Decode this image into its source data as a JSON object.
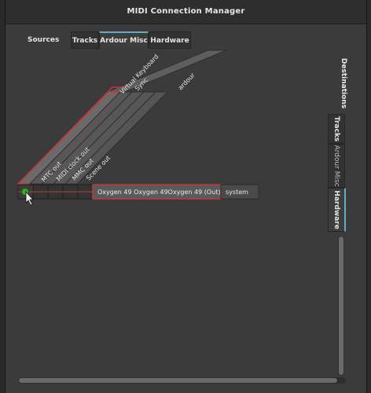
{
  "window": {
    "title": "MIDI Connection Manager"
  },
  "source_tabs": {
    "heading": "Sources",
    "items": [
      {
        "label": "Tracks",
        "active": false
      },
      {
        "label": "Ardour Misc",
        "active": true
      },
      {
        "label": "Hardware",
        "active": false
      }
    ]
  },
  "destination_tabs": {
    "heading": "Destinations",
    "items": [
      {
        "label": "Tracks",
        "active": false
      },
      {
        "label": "Ardour Misc",
        "active": false
      },
      {
        "label": "Hardware",
        "active": true
      }
    ]
  },
  "matrix": {
    "column_groups": [
      {
        "label": "Virtual Keyboard"
      },
      {
        "label": "Sync"
      },
      {
        "label": "ardour"
      }
    ],
    "columns": [
      {
        "label": "MTC out"
      },
      {
        "label": "MIDI clock out"
      },
      {
        "label": "MMC out"
      },
      {
        "label": "Scene out"
      }
    ],
    "row": {
      "label": "Oxygen 49 Oxygen 49Oxygen 49 (Out)",
      "group": "system"
    },
    "connected_column": "MTC out"
  },
  "colors": {
    "highlight": "#c0393b",
    "accent": "#6aa8c4",
    "connected": "#3fa535"
  }
}
